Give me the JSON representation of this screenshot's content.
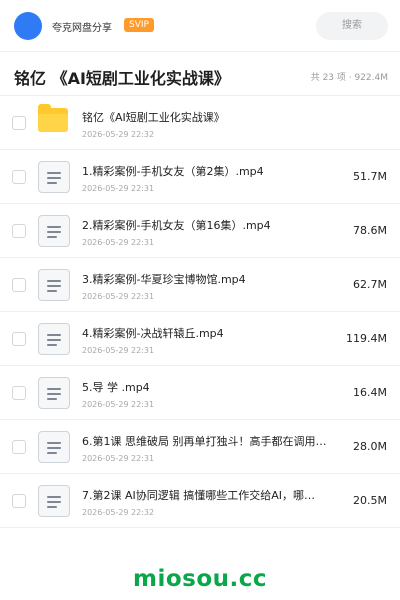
{
  "header": {
    "share_name": "夸克网盘分享",
    "badge": "SVIP",
    "search_placeholder": "搜索"
  },
  "folder": {
    "title": "铭亿 《AI短剧工业化实战课》",
    "summary": "共 23 项 · 922.4M"
  },
  "items": [
    {
      "type": "folder",
      "icon": "folder-icon",
      "name": "铭亿《AI短剧工业化实战课》",
      "date": "2026-05-29 22:32",
      "size": ""
    },
    {
      "type": "file",
      "icon": "file-icon",
      "name": "1.精彩案例-手机女友（第2集）.mp4",
      "date": "2026-05-29 22:31",
      "size": "51.7M"
    },
    {
      "type": "file",
      "icon": "file-icon",
      "name": "2.精彩案例-手机女友（第16集）.mp4",
      "date": "2026-05-29 22:31",
      "size": "78.6M"
    },
    {
      "type": "file",
      "icon": "file-icon",
      "name": "3.精彩案例-华夏珍宝博物馆.mp4",
      "date": "2026-05-29 22:31",
      "size": "62.7M"
    },
    {
      "type": "file",
      "icon": "file-icon",
      "name": "4.精彩案例-决战轩辕丘.mp4",
      "date": "2026-05-29 22:31",
      "size": "119.4M"
    },
    {
      "type": "file",
      "icon": "file-icon",
      "name": "5.导 学 .mp4",
      "date": "2026-05-29 22:31",
      "size": "16.4M"
    },
    {
      "type": "file",
      "icon": "file-icon",
      "name": "6.第1课 思维破局 别再单打独斗！高手都在调用A…",
      "date": "2026-05-29 22:31",
      "size": "28.0M"
    },
    {
      "type": "file",
      "icon": "file-icon",
      "name": "7.第2课 AI协同逻辑 搞懂哪些工作交给AI，哪…",
      "date": "2026-05-29 22:32",
      "size": "20.5M"
    }
  ],
  "watermark": "miosou.cc",
  "colors": {
    "accent_blue": "#2f7bf6",
    "svip_orange": "#ff9b2a",
    "folder_yellow": "#ffc82d",
    "watermark_green": "#0aa64a"
  }
}
